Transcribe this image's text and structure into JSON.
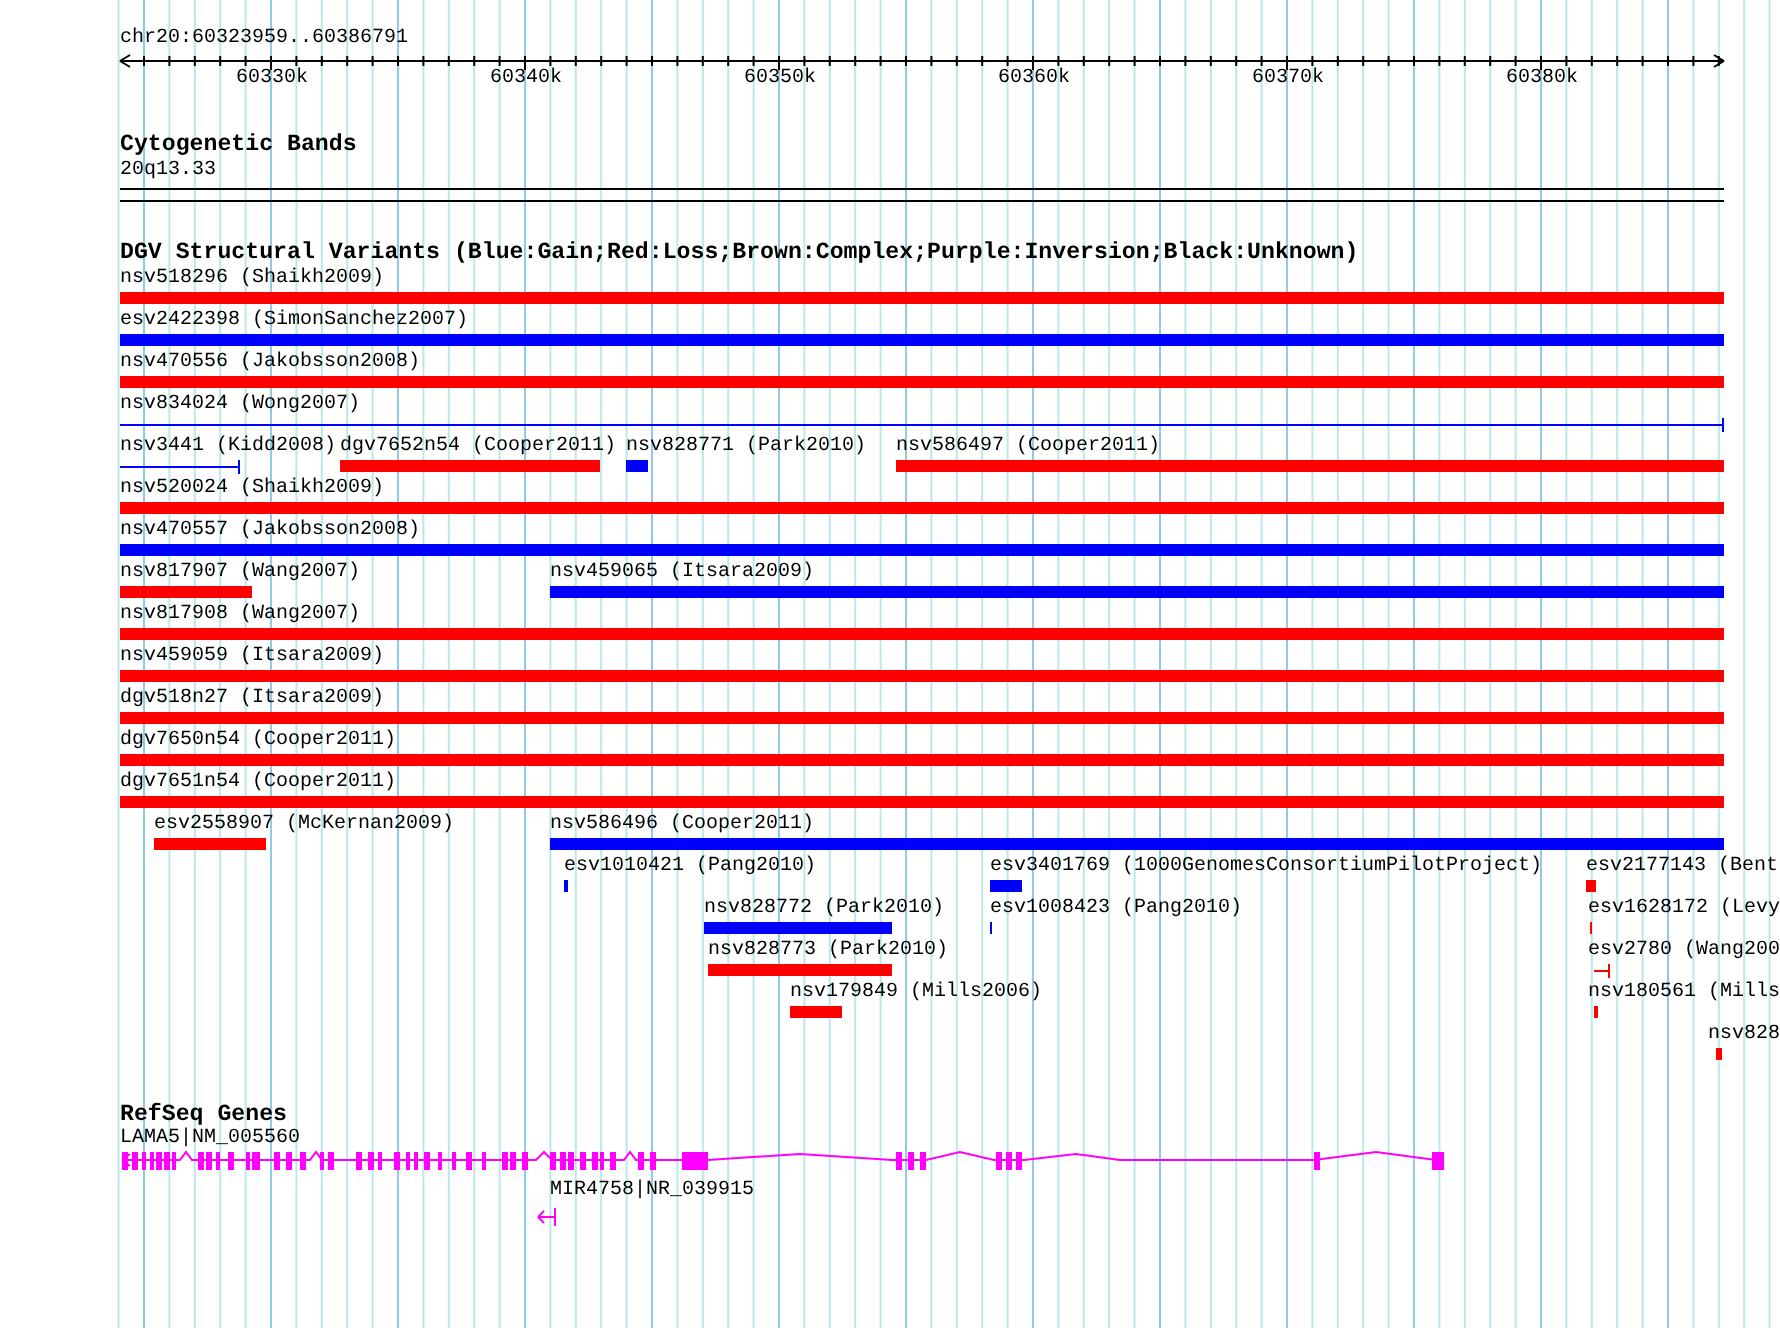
{
  "region": "chr20:60323959..60386791",
  "scale_labels": [
    "60330k",
    "60340k",
    "60350k",
    "60360k",
    "60370k",
    "60380k"
  ],
  "tracks": [
    {
      "kind": "bands",
      "title": "Cytogenetic Bands",
      "band": "20q13.33"
    },
    {
      "kind": "variants",
      "title": "DGV Structural Variants (Blue:Gain;Red:Loss;Brown:Complex;Purple:Inversion;Black:Unknown)",
      "features": [
        {
          "label": "nsv518296 (Shaikh2009)",
          "color": "#ff0000",
          "kind": "bar"
        },
        {
          "label": "esv2422398 (SimonSanchez2007)",
          "color": "#0000ff",
          "kind": "bar"
        },
        {
          "label": "nsv470556 (Jakobsson2008)",
          "color": "#ff0000",
          "kind": "bar"
        },
        {
          "label": "nsv834024 (Wong2007)",
          "color": "#0000ff",
          "kind": "line"
        },
        {
          "label": "nsv3441 (Kidd2008)",
          "color": "#0000ff",
          "kind": "line"
        },
        {
          "label": "dgv7652n54 (Cooper2011)",
          "color": "#ff0000",
          "kind": "bar"
        },
        {
          "label": "nsv828771 (Park2010)",
          "color": "#0000ff",
          "kind": "bar"
        },
        {
          "label": "nsv586497 (Cooper2011)",
          "color": "#ff0000",
          "kind": "bar"
        },
        {
          "label": "nsv520024 (Shaikh2009)",
          "color": "#ff0000",
          "kind": "bar"
        },
        {
          "label": "nsv470557 (Jakobsson2008)",
          "color": "#0000ff",
          "kind": "bar"
        },
        {
          "label": "nsv817907 (Wang2007)",
          "color": "#ff0000",
          "kind": "bar"
        },
        {
          "label": "nsv459065 (Itsara2009)",
          "color": "#0000ff",
          "kind": "bar"
        },
        {
          "label": "nsv817908 (Wang2007)",
          "color": "#ff0000",
          "kind": "bar"
        },
        {
          "label": "nsv459059 (Itsara2009)",
          "color": "#ff0000",
          "kind": "bar"
        },
        {
          "label": "dgv518n27 (Itsara2009)",
          "color": "#ff0000",
          "kind": "bar"
        },
        {
          "label": "dgv7650n54 (Cooper2011)",
          "color": "#ff0000",
          "kind": "bar"
        },
        {
          "label": "dgv7651n54 (Cooper2011)",
          "color": "#ff0000",
          "kind": "bar"
        },
        {
          "label": "esv2558907 (McKernan2009)",
          "color": "#ff0000",
          "kind": "bar"
        },
        {
          "label": "nsv586496 (Cooper2011)",
          "color": "#0000ff",
          "kind": "bar"
        },
        {
          "label": "esv1010421 (Pang2010)",
          "color": "#0000ff",
          "kind": "bar"
        },
        {
          "label": "esv3401769 (1000GenomesConsortiumPilotProject)",
          "color": "#0000ff",
          "kind": "bar"
        },
        {
          "label": "esv2177143 (Bent",
          "color": "#ff0000",
          "kind": "bar"
        },
        {
          "label": "nsv828772 (Park2010)",
          "color": "#0000ff",
          "kind": "bar"
        },
        {
          "label": "esv1008423 (Pang2010)",
          "color": "#0000ff",
          "kind": "bar"
        },
        {
          "label": "esv1628172 (Levy",
          "color": "#ff0000",
          "kind": "bar"
        },
        {
          "label": "nsv828773 (Park2010)",
          "color": "#ff0000",
          "kind": "bar"
        },
        {
          "label": "esv2780 (Wang200",
          "color": "#ff0000",
          "kind": "line"
        },
        {
          "label": "nsv179849 (Mills2006)",
          "color": "#ff0000",
          "kind": "bar"
        },
        {
          "label": "nsv180561 (Mills",
          "color": "#ff0000",
          "kind": "bar"
        },
        {
          "label": "nsv828",
          "color": "#ff0000",
          "kind": "bar"
        }
      ]
    },
    {
      "kind": "genes",
      "title": "RefSeq Genes",
      "genes": [
        {
          "label": "LAMA5|NM_005560"
        },
        {
          "label": "MIR4758|NR_039915"
        }
      ]
    }
  ]
}
